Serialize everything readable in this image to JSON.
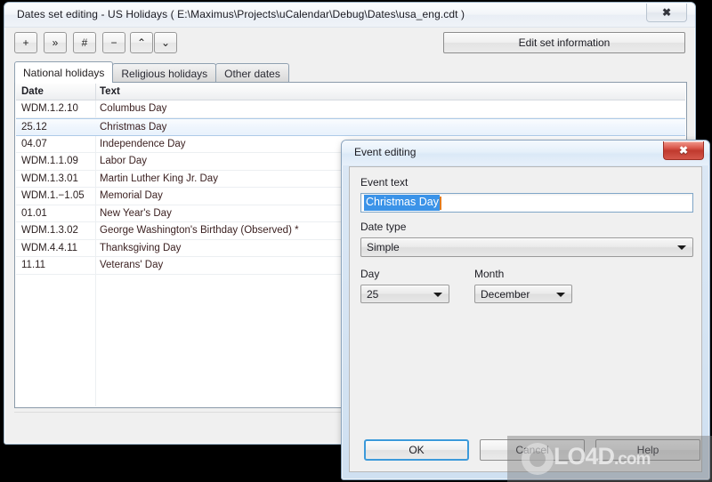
{
  "main_window": {
    "title": "Dates set editing - US Holidays ( E:\\Maximus\\Projects\\uCalendar\\Debug\\Dates\\usa_eng.cdt )",
    "close_glyph": "✖",
    "toolbar": {
      "buttons": [
        {
          "name": "add",
          "label": "+"
        },
        {
          "name": "duplicate",
          "label": "»"
        },
        {
          "name": "number",
          "label": "#"
        },
        {
          "name": "remove",
          "label": "−"
        },
        {
          "name": "move-up",
          "label": "⌃"
        },
        {
          "name": "move-down",
          "label": "⌄"
        }
      ],
      "edit_set_information_label": "Edit set information"
    },
    "tabs": [
      {
        "label": "National holidays",
        "active": true
      },
      {
        "label": "Religious holidays",
        "active": false
      },
      {
        "label": "Other dates",
        "active": false
      }
    ],
    "list": {
      "columns": [
        "Date",
        "Text"
      ],
      "rows": [
        {
          "date": "WDM.1.2.10",
          "text": "Columbus Day",
          "selected": false
        },
        {
          "date": "25.12",
          "text": "Christmas Day",
          "selected": true
        },
        {
          "date": "04.07",
          "text": "Independence Day",
          "selected": false
        },
        {
          "date": "WDM.1.1.09",
          "text": "Labor Day",
          "selected": false
        },
        {
          "date": "WDM.1.3.01",
          "text": "Martin Luther King Jr. Day",
          "selected": false
        },
        {
          "date": "WDM.1.−1.05",
          "text": "Memorial Day",
          "selected": false
        },
        {
          "date": "01.01",
          "text": "New Year's Day",
          "selected": false
        },
        {
          "date": "WDM.1.3.02",
          "text": "George Washington's Birthday (Observed) *",
          "selected": false
        },
        {
          "date": "WDM.4.4.11",
          "text": "Thanksgiving Day",
          "selected": false
        },
        {
          "date": "11.11",
          "text": "Veterans' Day",
          "selected": false
        }
      ]
    }
  },
  "dialog": {
    "title": "Event editing",
    "close_glyph": "✖",
    "event_text": {
      "label": "Event text",
      "value": "Christmas Day",
      "selected": true
    },
    "date_type": {
      "label": "Date type",
      "value": "Simple"
    },
    "day": {
      "label": "Day",
      "value": "25"
    },
    "month": {
      "label": "Month",
      "value": "December"
    },
    "buttons": {
      "ok": "OK",
      "cancel": "Cancel",
      "help": "Help"
    }
  },
  "watermark": {
    "text": "LO4D",
    "domain": ".com"
  },
  "colors": {
    "selection_blue": "#3b93e8",
    "focus_border": "#3c9ada",
    "dialog_close_red": "#c03a2e",
    "window_frame": "#8ba4bd"
  }
}
